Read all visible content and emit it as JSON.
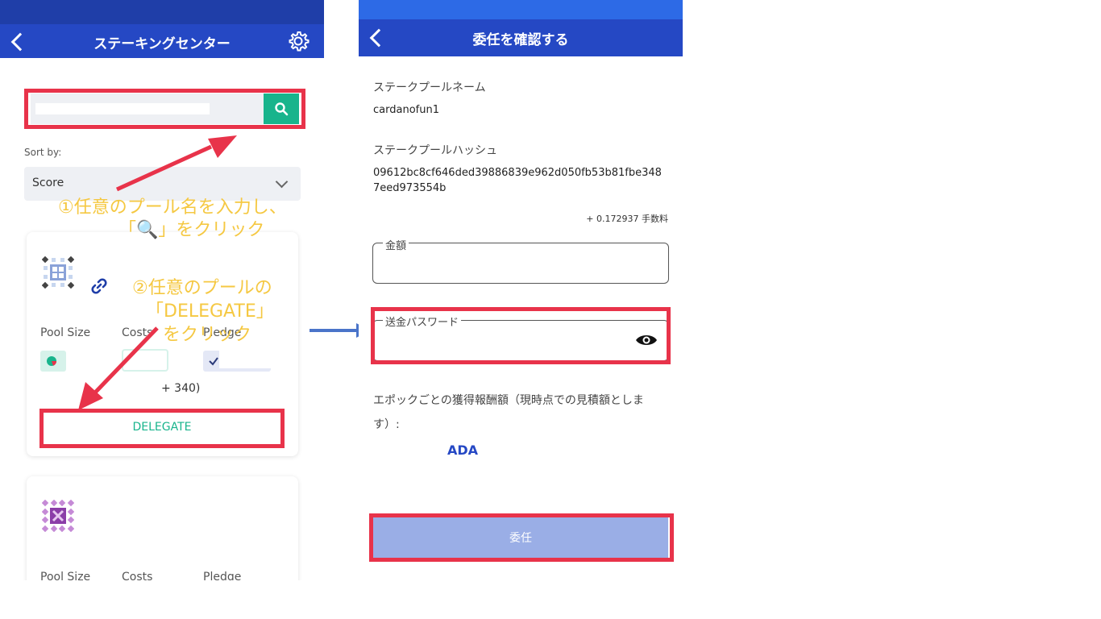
{
  "left": {
    "title": "ステーキングセンター",
    "sort_label": "Sort by:",
    "sort_value": "Score",
    "pool_card": {
      "pool_size_label": "Pool Size",
      "costs_label": "Costs",
      "pledge_label": "Pledge",
      "costs_value": "+ 340)",
      "delegate_label": "DELEGATE"
    },
    "pool_card2": {
      "pool_size_label": "Pool Size",
      "costs_label": "Costs",
      "pledge_label": "Pledge"
    },
    "annotation1_line1": "①任意のプール名を入力し、",
    "annotation1_line2": "「🔍」をクリック",
    "annotation2_line1": "②任意のプールの",
    "annotation2_line2": "「DELEGATE」",
    "annotation2_line3": "をクリック"
  },
  "right": {
    "title": "委任を確認する",
    "pool_name_label": "ステークプールネーム",
    "pool_name_value": "cardanofun1",
    "pool_hash_label": "ステークプールハッシュ",
    "pool_hash_line1": "09612bc8cf646ded39886839e962d050fb53b81fbe348",
    "pool_hash_line2": "7eed973554b",
    "fee_text": "+ 0.172937 手数料",
    "amount_label": "金額",
    "password_label": "送金パスワード",
    "reward_label_line1": "エポックごとの獲得報酬額（現時点での見積額としま",
    "reward_label_line2": "す）:",
    "reward_currency": "ADA",
    "submit_label": "委任"
  },
  "colors": {
    "header_blue": "#2548c4",
    "accent_green": "#18b48c",
    "highlight_red": "#e8334a",
    "annotation_yellow": "#f5c842",
    "arrow_blue": "#4a74c9"
  }
}
